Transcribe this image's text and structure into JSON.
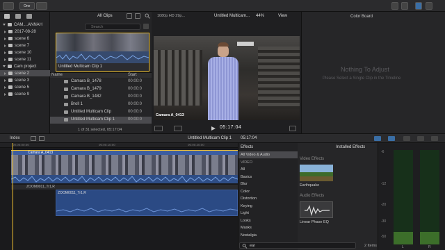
{
  "toolbar": {
    "label_one": "One"
  },
  "library": {
    "items": [
      {
        "label": "CAM....ANNAH",
        "type": "library"
      },
      {
        "label": "2017-08-28",
        "type": "event"
      },
      {
        "label": "scene 6",
        "type": "event"
      },
      {
        "label": "scene 7",
        "type": "event"
      },
      {
        "label": "scene 10",
        "type": "event"
      },
      {
        "label": "scene 11",
        "type": "event"
      },
      {
        "label": "Cam project",
        "type": "library"
      },
      {
        "label": "scene 2",
        "type": "event",
        "selected": true
      },
      {
        "label": "scene 3",
        "type": "event"
      },
      {
        "label": "scene 5",
        "type": "event"
      },
      {
        "label": "scene 9",
        "type": "event"
      }
    ]
  },
  "browser": {
    "filter_label": "All Clips",
    "search_placeholder": "Search",
    "thumb_caption": "Untitled Multicam Clip 1",
    "col_name": "Name",
    "col_start": "Start",
    "rows": [
      {
        "name": "Camara B_1478",
        "start": "00:00:0"
      },
      {
        "name": "Camara B_1479",
        "start": "00:00:0"
      },
      {
        "name": "Camara B_1482",
        "start": "00:00:0"
      },
      {
        "name": "Broll 1",
        "start": "00:00:0"
      },
      {
        "name": "Untitled Multicam Clip",
        "start": "00:00:0"
      },
      {
        "name": "Untitled Multicam Clip 1",
        "start": "00:00:0"
      }
    ],
    "status": "1 of 31 selected, 05:17:04"
  },
  "viewer": {
    "format": "1080p HD 29p...",
    "title": "Untitled Multicam...",
    "zoom": "44%",
    "view_label": "View",
    "angle_label": "Camara A_0413",
    "timecode": "05:17:04"
  },
  "inspector": {
    "title": "Color Board",
    "heading": "Nothing To Adjust",
    "subtext": "Please Select a Single Clip in the Timeline"
  },
  "timeline_bar": {
    "index": "Index",
    "clip_title": "Untitled Multicam Clip 1",
    "duration": "05:17:04"
  },
  "timeline": {
    "clip_a_label": "Camara A_0413",
    "clip_b_label": "ZOOM0011_Tr1,R",
    "audio_b_label": "ZOOM0011_Tr1,R",
    "ruler": [
      "00:00:00:00",
      "00:00:10:00",
      "00:00:20:00"
    ]
  },
  "effects": {
    "header": "Effects",
    "categories": [
      "All Video & Audio",
      "VIDEO",
      "All",
      "Basics",
      "Blur",
      "Color",
      "Distortion",
      "Keying",
      "Light",
      "Looks",
      "Masks",
      "Nostalgia"
    ],
    "selected": "All Video & Audio",
    "installed": "Installed Effects",
    "video_section": "Video Effects",
    "video_item": "Earthquake",
    "audio_section": "Audio Effects",
    "audio_item": "Linear Phase EQ",
    "search_value": "ear",
    "count": "2 Items"
  },
  "meters": {
    "scale": [
      "-6",
      "-12",
      "-20",
      "-30",
      "-50"
    ],
    "channels": [
      "L",
      "R"
    ],
    "level_fraction": 0.13
  }
}
